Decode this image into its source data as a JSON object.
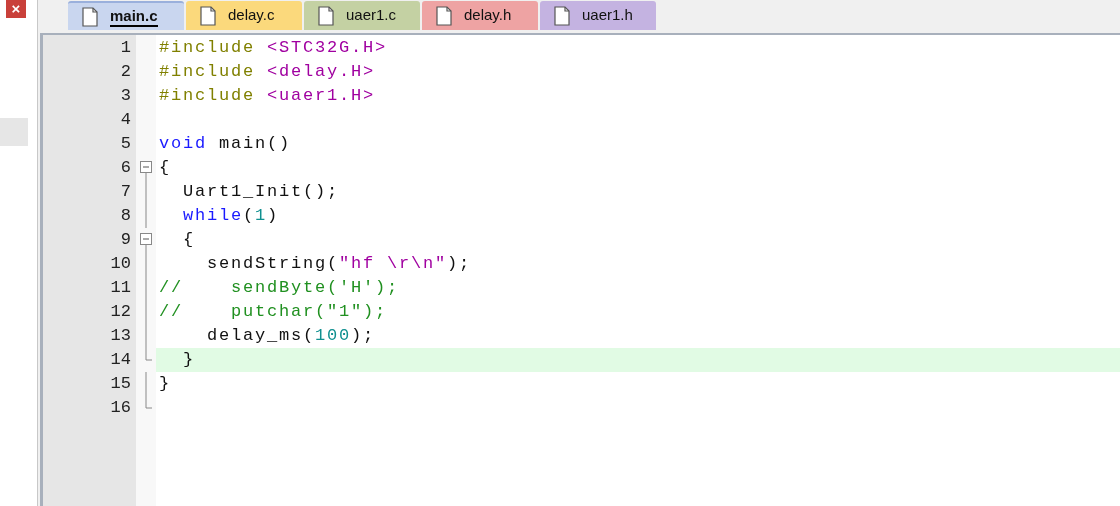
{
  "close_button": {
    "label": "×"
  },
  "tabs": [
    {
      "label": "main.c",
      "selected": true,
      "color": "#c9d6ef"
    },
    {
      "label": "delay.c",
      "selected": false,
      "color": "#fbd97c"
    },
    {
      "label": "uaer1.c",
      "selected": false,
      "color": "#c4d1a3"
    },
    {
      "label": "delay.h",
      "selected": false,
      "color": "#eea3a3"
    },
    {
      "label": "uaer1.h",
      "selected": false,
      "color": "#c4b3e1"
    }
  ],
  "editor": {
    "lines": [
      {
        "number": "1",
        "current": false,
        "tokens": [
          {
            "kind": "preproc",
            "text": "#include "
          },
          {
            "kind": "header",
            "text": "<STC32G.H>"
          }
        ]
      },
      {
        "number": "2",
        "current": false,
        "tokens": [
          {
            "kind": "preproc",
            "text": "#include "
          },
          {
            "kind": "header",
            "text": "<delay.H>"
          }
        ]
      },
      {
        "number": "3",
        "current": false,
        "tokens": [
          {
            "kind": "preproc",
            "text": "#include "
          },
          {
            "kind": "header",
            "text": "<uaer1.H>"
          }
        ]
      },
      {
        "number": "4",
        "current": false
      },
      {
        "number": "5",
        "current": false,
        "tokens": [
          {
            "kind": "keyword",
            "text": "void"
          },
          {
            "kind": "plain",
            "text": " main()"
          }
        ]
      },
      {
        "number": "6",
        "fold": {
          "kind": "start"
        },
        "current": false,
        "tokens": [
          {
            "kind": "plain",
            "text": "{"
          }
        ]
      },
      {
        "number": "7",
        "fold": {
          "kind": "line"
        },
        "current": false,
        "tokens": [
          {
            "kind": "plain",
            "text": "  Uart1_Init();"
          }
        ]
      },
      {
        "number": "8",
        "fold": {
          "kind": "line"
        },
        "current": false,
        "tokens": [
          {
            "kind": "keyword",
            "text": "  while"
          },
          {
            "kind": "plain",
            "text": "("
          },
          {
            "kind": "number",
            "text": "1"
          },
          {
            "kind": "plain",
            "text": ")"
          }
        ]
      },
      {
        "number": "9",
        "fold": {
          "kind": "start"
        },
        "current": false,
        "tokens": [
          {
            "kind": "plain",
            "text": "  {"
          }
        ]
      },
      {
        "number": "10",
        "fold": {
          "kind": "line"
        },
        "current": false,
        "tokens": [
          {
            "kind": "plain",
            "text": "    sendString("
          },
          {
            "kind": "string",
            "text": "\"hf \\r\\n\""
          },
          {
            "kind": "plain",
            "text": ");"
          }
        ]
      },
      {
        "number": "11",
        "fold": {
          "kind": "line"
        },
        "current": false,
        "tokens": [
          {
            "kind": "comment",
            "text": "//    sendByte('H');"
          }
        ]
      },
      {
        "number": "12",
        "fold": {
          "kind": "line"
        },
        "current": false,
        "tokens": [
          {
            "kind": "comment",
            "text": "//    putchar(\"1\");"
          }
        ]
      },
      {
        "number": "13",
        "fold": {
          "kind": "line"
        },
        "current": false,
        "tokens": [
          {
            "kind": "plain",
            "text": "    delay_ms("
          },
          {
            "kind": "number",
            "text": "100"
          },
          {
            "kind": "plain",
            "text": ");"
          }
        ]
      },
      {
        "number": "14",
        "fold": {
          "kind": "end"
        },
        "current": true,
        "tokens": [
          {
            "kind": "plain",
            "text": "  }"
          }
        ]
      },
      {
        "number": "15",
        "fold": {
          "kind": "line"
        },
        "current": false,
        "tokens": [
          {
            "kind": "plain",
            "text": "}"
          }
        ]
      },
      {
        "number": "16",
        "fold": {
          "kind": "end"
        },
        "current": false
      }
    ]
  }
}
